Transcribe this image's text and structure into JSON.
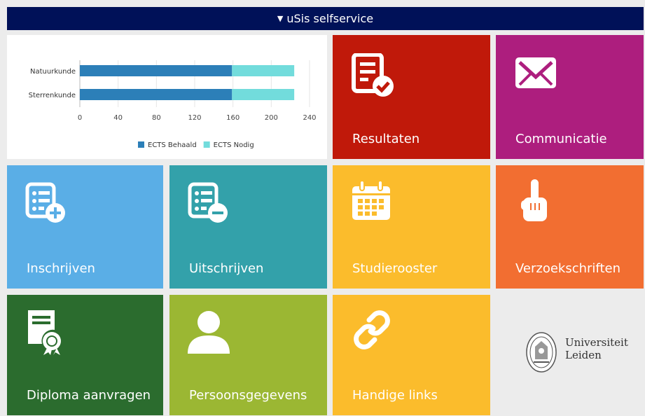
{
  "header": {
    "title": "uSis selfservice"
  },
  "chart_data": {
    "type": "bar",
    "orientation": "horizontal",
    "stacked": true,
    "categories": [
      "Natuurkunde",
      "Sterrenkunde"
    ],
    "series": [
      {
        "name": "ECTS Behaald",
        "values": [
          159,
          159
        ],
        "color": "#2c7fb8"
      },
      {
        "name": "ECTS Nodig",
        "values": [
          65,
          65
        ],
        "color": "#72dcdc"
      }
    ],
    "xticks": [
      "0",
      "40",
      "80",
      "120",
      "160",
      "200",
      "240"
    ],
    "xlim": [
      0,
      240
    ],
    "legend_position": "bottom",
    "grid": true
  },
  "tiles": {
    "resultaten": {
      "label": "Resultaten",
      "color": "#c0190a",
      "icon": "document-check-icon"
    },
    "communicatie": {
      "label": "Communicatie",
      "color": "#ad1e7e",
      "icon": "envelope-icon"
    },
    "inschrijven": {
      "label": "Inschrijven",
      "color": "#5aaee6",
      "icon": "list-add-icon"
    },
    "uitschrijven": {
      "label": "Uitschrijven",
      "color": "#33a1aa",
      "icon": "list-remove-icon"
    },
    "studierooster": {
      "label": "Studierooster",
      "color": "#fbbc2c",
      "icon": "calendar-icon"
    },
    "verzoekschriften": {
      "label": "Verzoekschriften",
      "color": "#f26e31",
      "icon": "pointing-hand-icon"
    },
    "diploma": {
      "label": "Diploma aanvragen",
      "color": "#2b6c2e",
      "icon": "certificate-icon"
    },
    "persoonsgegevens": {
      "label": "Persoonsgegevens",
      "color": "#9bb733",
      "icon": "person-icon"
    },
    "handige_links": {
      "label": "Handige links",
      "color": "#fbbc2c",
      "icon": "link-icon"
    }
  },
  "logo": {
    "line1": "Universiteit",
    "line2": "Leiden",
    "icon": "university-seal-icon"
  }
}
